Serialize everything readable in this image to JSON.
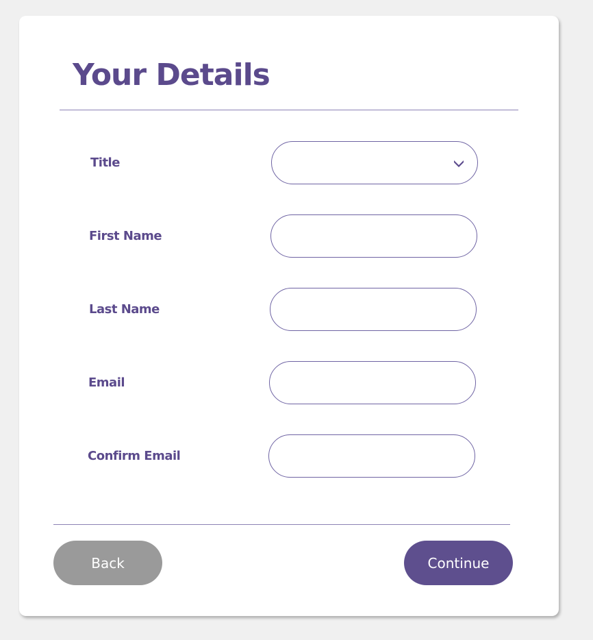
{
  "form": {
    "title": "Your Details",
    "fields": [
      {
        "label": "Title",
        "type": "select",
        "value": ""
      },
      {
        "label": "First Name",
        "type": "text",
        "value": ""
      },
      {
        "label": "Last Name",
        "type": "text",
        "value": ""
      },
      {
        "label": "Email",
        "type": "text",
        "value": ""
      },
      {
        "label": "Confirm Email",
        "type": "text",
        "value": ""
      }
    ],
    "icons": {
      "select": "chevron-down-icon"
    }
  },
  "actions": {
    "back_label": "Back",
    "continue_label": "Continue"
  },
  "colors": {
    "accent": "#5b4a8c",
    "back_button": "#9a9a9a",
    "continue_button": "#5e4f8e",
    "background": "#f0f0f0"
  }
}
